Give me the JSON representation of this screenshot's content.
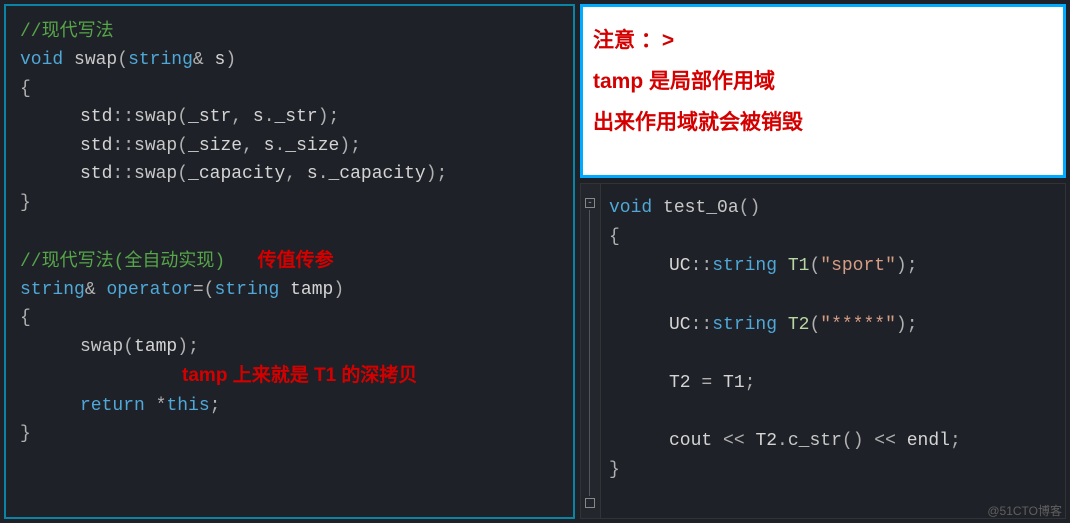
{
  "left_editor": {
    "comment1": "//现代写法",
    "kw_void": "void",
    "fn_swap": "swap",
    "type_string": "string",
    "amp": "&",
    "param_s": "s",
    "ns_std": "std",
    "scope": "::",
    "call_swap": "swap",
    "field_str": "_str",
    "field_size": "_size",
    "field_capacity": "_capacity",
    "obj_s": "s",
    "dot": ".",
    "comma_sp": ", ",
    "semi": ";",
    "lbrace": "{",
    "rbrace": "}",
    "lparen": "(",
    "rparen": ")",
    "comment2": "//现代写法(全自动实现)",
    "anno_pass_by_value": "传值传参",
    "ret_stringref": "string",
    "kw_operator": "operator",
    "op_assign": "=",
    "param_tamp": "tamp",
    "call_swap2": "swap",
    "anno_tamp_deep": "tamp 上来就是 T1 的深拷贝",
    "kw_return": "return",
    "star_this": "*this"
  },
  "note_box": {
    "line1": "注意 ：>",
    "line2": "tamp 是局部作用域",
    "line3": "出来作用域就会被销毁"
  },
  "right_editor": {
    "kw_void": "void",
    "fn_test": "test_0a",
    "lparen": "(",
    "rparen": ")",
    "lbrace": "{",
    "rbrace": "}",
    "ns_uc": "UC",
    "scope": "::",
    "type_string": "string",
    "var_t1": "T1",
    "str_sport": "\"sport\"",
    "var_t2": "T2",
    "str_stars": "\"*****\"",
    "assign_lhs": "T2",
    "op_eq": " = ",
    "assign_rhs": "T1",
    "semi": ";",
    "cout": "cout",
    "op_ins": " << ",
    "dot": ".",
    "fn_cstr": "c_str",
    "endl": "endl"
  },
  "gutter": {
    "minus": "-",
    "end_box": " "
  },
  "watermark": "@51CTO博客"
}
